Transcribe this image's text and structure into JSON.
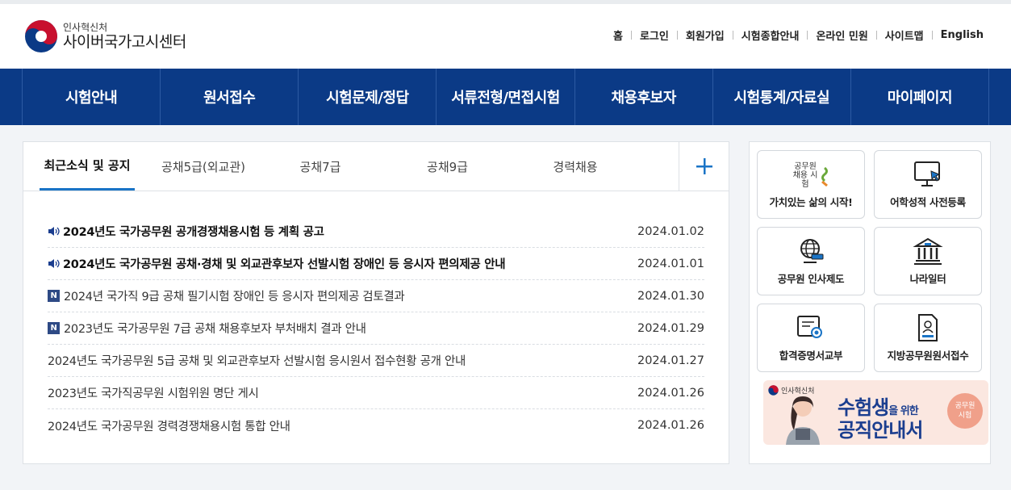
{
  "logo": {
    "sub": "인사혁신처",
    "main": "사이버국가고시센터"
  },
  "util_links": [
    "홈",
    "로그인",
    "회원가입",
    "시험종합안내",
    "온라인 민원",
    "사이트맵",
    "English"
  ],
  "gnb": [
    "시험안내",
    "원서접수",
    "시험문제/정답",
    "서류전형/면접시험",
    "채용후보자",
    "시험통계/자료실",
    "마이페이지"
  ],
  "notice": {
    "tabs": [
      "최근소식 및 공지",
      "공채5급(외교관)",
      "공채7급",
      "공채9급",
      "경력채용"
    ],
    "items": [
      {
        "title": "2024년도 국가공무원 공개경쟁채용시험 등 계획 공고",
        "date": "2024.01.02",
        "type": "speaker"
      },
      {
        "title": "2024년도 국가공무원 공채·경채 및 외교관후보자 선발시험 장애인 등 응시자 편의제공 안내",
        "date": "2024.01.01",
        "type": "speaker"
      },
      {
        "title": "2024년 국가직 9급 공채 필기시험 장애인 등 응시자 편의제공 검토결과",
        "date": "2024.01.30",
        "type": "new",
        "badge": "N"
      },
      {
        "title": "2023년도 국가공무원 7급 공채 채용후보자 부처배치 결과 안내",
        "date": "2024.01.29",
        "type": "new",
        "badge": "N"
      },
      {
        "title": "2024년도 국가공무원 5급 공채 및 외교관후보자 선발시험 응시원서 접수현황 공개 안내",
        "date": "2024.01.27",
        "type": "plain"
      },
      {
        "title": "2023년도 국가직공무원 시험위원 명단 게시",
        "date": "2024.01.26",
        "type": "plain"
      },
      {
        "title": "2024년도 국가공무원 경력경쟁채용시험 통합 안내",
        "date": "2024.01.26",
        "type": "plain"
      }
    ]
  },
  "quick": {
    "items": [
      {
        "label": "가치있는 삶의 시작!",
        "icon": "gongmuwon-logo-icon",
        "logo_text": "공무원 채용 시험"
      },
      {
        "label": "어학성적 사전등록",
        "icon": "monitor-cursor-icon"
      },
      {
        "label": "공무원 인사제도",
        "icon": "globe-gavel-icon"
      },
      {
        "label": "나라일터",
        "icon": "government-building-icon"
      },
      {
        "label": "합격증명서교부",
        "icon": "certificate-icon"
      },
      {
        "label": "지방공무원원서접수",
        "icon": "application-form-icon"
      }
    ]
  },
  "banner": {
    "org": "인사혁신처",
    "title_a": "수험생",
    "title_b": "을 위한",
    "title_c": "공직안내서",
    "badge_a": "공무원",
    "badge_b": "시험"
  },
  "colors": {
    "nav_bg": "#0b3a86",
    "tab_underline": "#1a74c6",
    "badge_bg": "#2e4a85",
    "banner_bg": "#fbe7e0"
  }
}
